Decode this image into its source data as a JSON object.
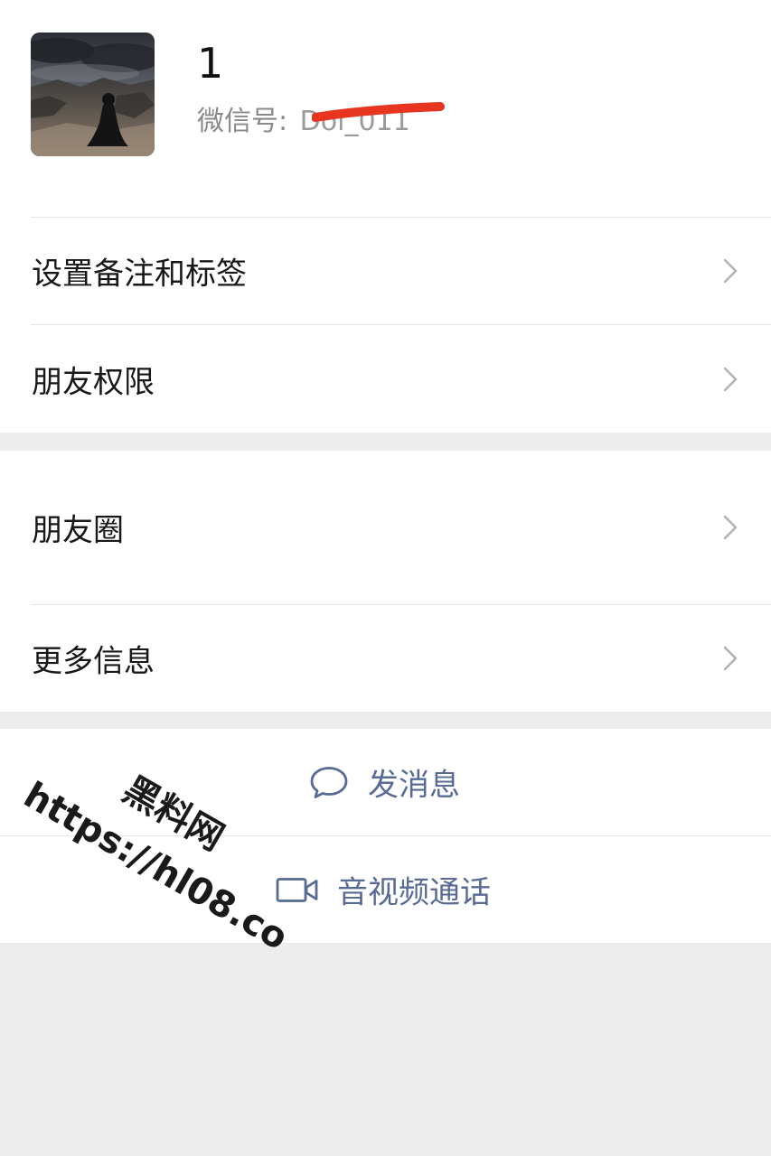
{
  "profile": {
    "nickname": "1",
    "wechat_id_label": "微信号:",
    "wechat_id_value": "Dol_011"
  },
  "menu_group_1": {
    "items": [
      {
        "label": "设置备注和标签",
        "icon": "chevron-right-icon"
      },
      {
        "label": "朋友权限",
        "icon": "chevron-right-icon"
      }
    ]
  },
  "menu_group_2": {
    "items": [
      {
        "label": "朋友圈",
        "icon": "chevron-right-icon"
      },
      {
        "label": "更多信息",
        "icon": "chevron-right-icon"
      }
    ]
  },
  "actions": {
    "send_message": {
      "label": "发消息",
      "icon": "chat-bubble-icon"
    },
    "video_call": {
      "label": "音视频通话",
      "icon": "video-camera-icon"
    }
  },
  "watermark": {
    "top_text": "黑料网",
    "url_text": "https://hl08.co"
  },
  "colors": {
    "background": "#ededed",
    "cell": "#ffffff",
    "link": "#576b95",
    "redaction": "#e8351f",
    "chevron": "#b2b2b2"
  }
}
